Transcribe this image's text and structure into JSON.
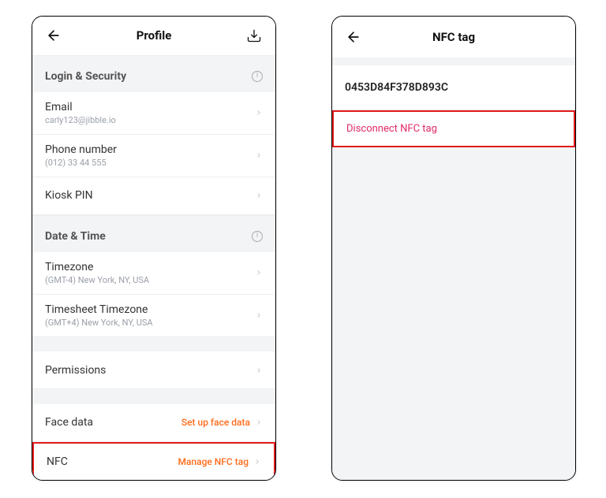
{
  "left": {
    "header": {
      "title": "Profile"
    },
    "sections": {
      "login_security": {
        "title": "Login & Security",
        "email": {
          "label": "Email",
          "value": "carly123@jibble.io"
        },
        "phone": {
          "label": "Phone number",
          "value": "(012) 33 44 555"
        },
        "kiosk": {
          "label": "Kiosk PIN"
        }
      },
      "date_time": {
        "title": "Date & Time",
        "timezone": {
          "label": "Timezone",
          "value": "(GMT-4) New York, NY, USA"
        },
        "ts_timezone": {
          "label": "Timesheet Timezone",
          "value": "(GMT+4) New York, NY, USA"
        }
      },
      "permissions": {
        "label": "Permissions"
      },
      "face": {
        "label": "Face data",
        "action": "Set up face data"
      },
      "nfc": {
        "label": "NFC",
        "action": "Manage NFC tag"
      }
    }
  },
  "right": {
    "header": {
      "title": "NFC tag"
    },
    "nfc_id": "0453D84F378D893C",
    "disconnect": "Disconnect NFC tag"
  }
}
